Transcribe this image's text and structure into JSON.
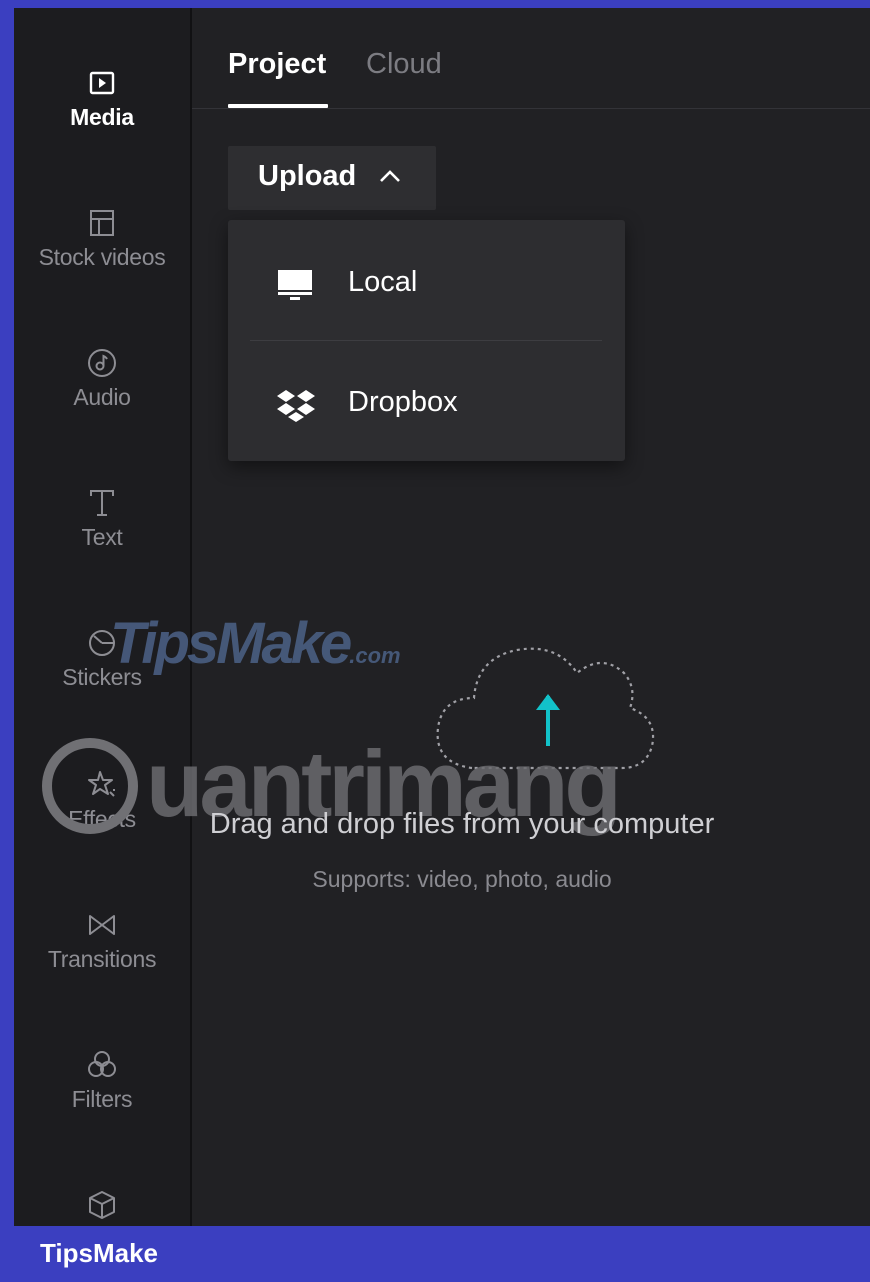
{
  "sidebar": {
    "items": [
      {
        "label": "Media",
        "icon": "media-icon",
        "active": true
      },
      {
        "label": "Stock videos",
        "icon": "stock-videos-icon",
        "active": false
      },
      {
        "label": "Audio",
        "icon": "audio-icon",
        "active": false
      },
      {
        "label": "Text",
        "icon": "text-icon",
        "active": false
      },
      {
        "label": "Stickers",
        "icon": "stickers-icon",
        "active": false
      },
      {
        "label": "Effects",
        "icon": "effects-icon",
        "active": false
      },
      {
        "label": "Transitions",
        "icon": "transitions-icon",
        "active": false
      },
      {
        "label": "Filters",
        "icon": "filters-icon",
        "active": false
      },
      {
        "label": "",
        "icon": "elements-icon",
        "active": false
      }
    ]
  },
  "tabs": [
    {
      "label": "Project",
      "active": true
    },
    {
      "label": "Cloud",
      "active": false
    }
  ],
  "upload": {
    "label": "Upload",
    "icon": "chevron-up-icon",
    "menu": [
      {
        "label": "Local",
        "icon": "computer-icon"
      },
      {
        "label": "Dropbox",
        "icon": "dropbox-icon"
      }
    ]
  },
  "drop_zone": {
    "title": "Drag and drop files from your computer",
    "subtitle": "Supports: video, photo, audio",
    "icon": "cloud-upload-icon"
  },
  "watermarks": {
    "tipsmake": "TipsMake",
    "tipsmake_suffix": ".com",
    "quantrimang": "uantrimang"
  },
  "brand": {
    "label": "TipsMake"
  },
  "colors": {
    "accent": "#12c2c9",
    "frame": "#3b3fc0",
    "background": "#212124"
  }
}
